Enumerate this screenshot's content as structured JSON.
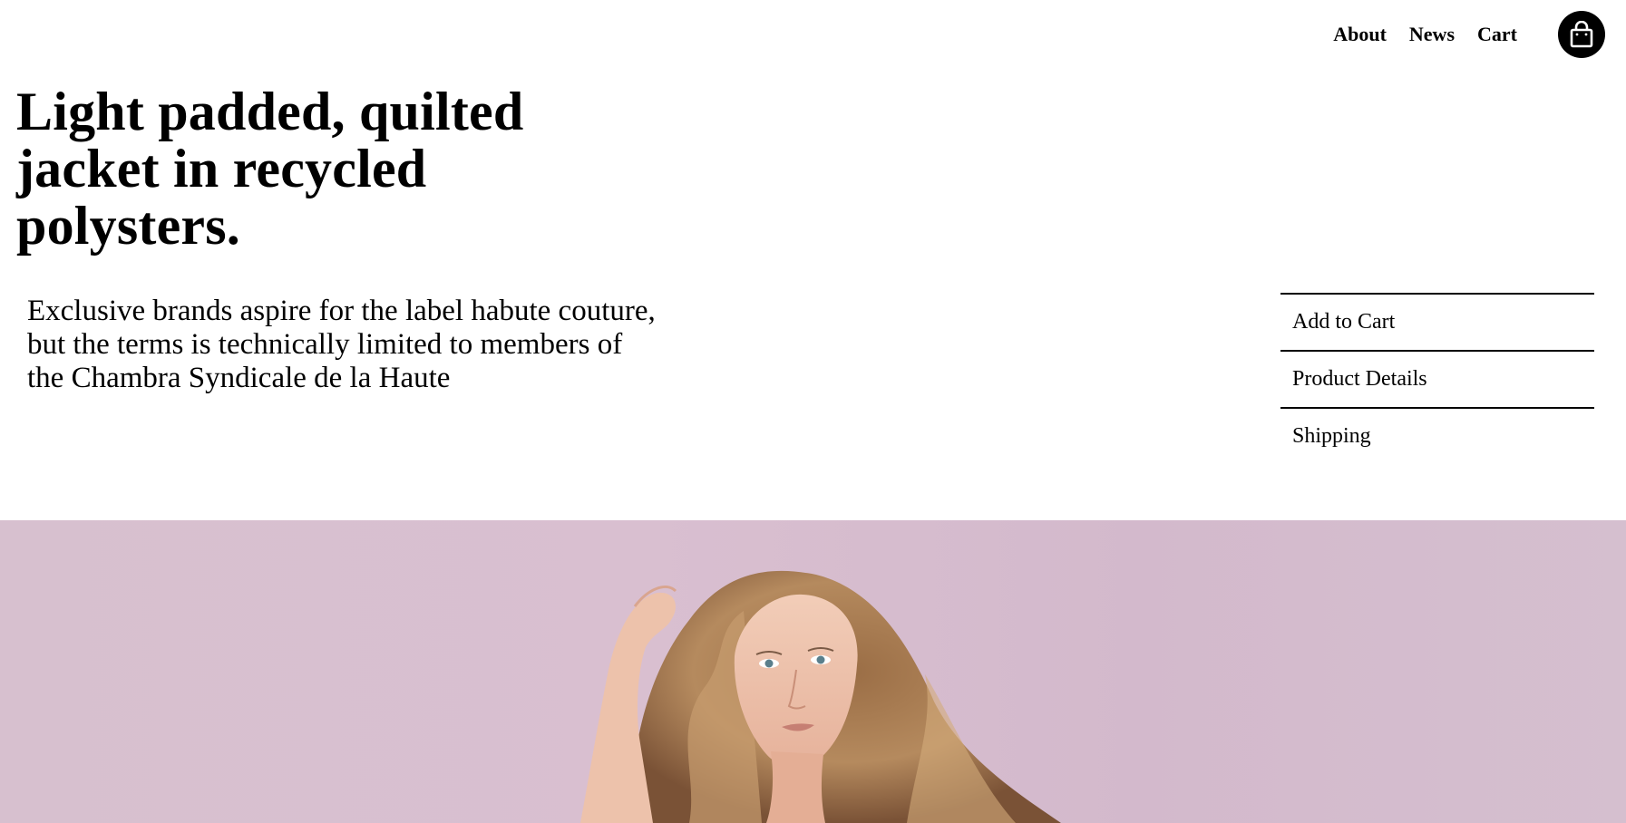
{
  "nav": {
    "links": [
      {
        "label": "About"
      },
      {
        "label": "News"
      },
      {
        "label": "Cart"
      }
    ],
    "bag_icon": "shopping-bag-icon"
  },
  "product": {
    "title": "Light padded, quilted jacket in recycled polysters.",
    "description": "Exclusive brands aspire for the label habute couture, but the terms is technically limited to members of the Chambra Syndicale de la Haute"
  },
  "actions": [
    {
      "label": "Add to Cart"
    },
    {
      "label": "Product Details"
    },
    {
      "label": "Shipping"
    }
  ],
  "hero": {
    "description_icon": "model-portrait-image",
    "background_color": "#d8c0d0"
  }
}
